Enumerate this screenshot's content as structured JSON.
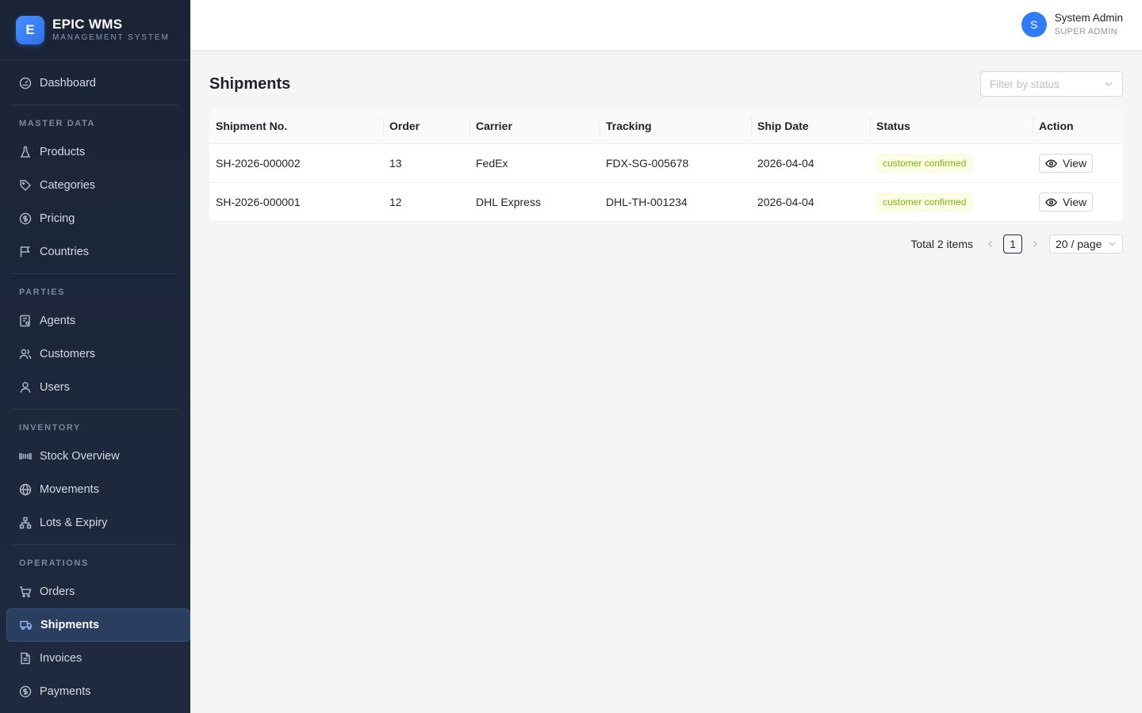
{
  "brand": {
    "logo_letter": "E",
    "title": "EPIC WMS",
    "subtitle": "MANAGEMENT SYSTEM"
  },
  "user": {
    "initial": "S",
    "name": "System Admin",
    "role": "SUPER ADMIN"
  },
  "sidebar": {
    "dashboard": "Dashboard",
    "sections": {
      "master_data": "MASTER DATA",
      "parties": "PARTIES",
      "inventory": "INVENTORY",
      "operations": "OPERATIONS"
    },
    "items": {
      "products": "Products",
      "categories": "Categories",
      "pricing": "Pricing",
      "countries": "Countries",
      "agents": "Agents",
      "customers": "Customers",
      "users": "Users",
      "stock_overview": "Stock Overview",
      "movements": "Movements",
      "lots_expiry": "Lots & Expiry",
      "orders": "Orders",
      "shipments": "Shipments",
      "invoices": "Invoices",
      "payments": "Payments"
    },
    "active": "Shipments"
  },
  "page": {
    "title": "Shipments",
    "filter_placeholder": "Filter by status"
  },
  "table": {
    "columns": [
      "Shipment No.",
      "Order",
      "Carrier",
      "Tracking",
      "Ship Date",
      "Status",
      "Action"
    ],
    "rows": [
      {
        "shipment_no": "SH-2026-000002",
        "order": "13",
        "carrier": "FedEx",
        "tracking": "FDX-SG-005678",
        "ship_date": "2026-04-04",
        "status": "customer confirmed",
        "action": "View"
      },
      {
        "shipment_no": "SH-2026-000001",
        "order": "12",
        "carrier": "DHL Express",
        "tracking": "DHL-TH-001234",
        "ship_date": "2026-04-04",
        "status": "customer confirmed",
        "action": "View"
      }
    ]
  },
  "pagination": {
    "total": "Total 2 items",
    "current_page": "1",
    "page_size": "20 / page"
  },
  "colors": {
    "sidebar_bg": "#1b2436",
    "accent": "#2f7cf6",
    "status_tag_text": "#7cb305",
    "status_tag_bg": "#fcffe6"
  }
}
